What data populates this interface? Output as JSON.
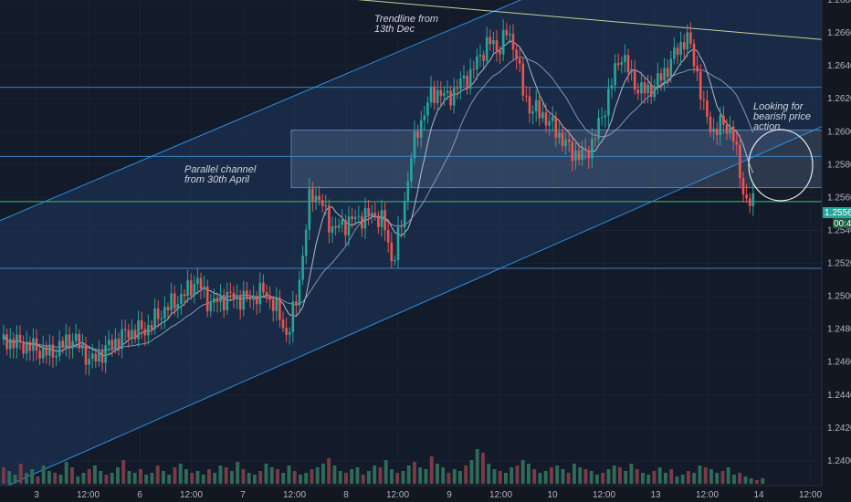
{
  "chart_data": {
    "type": "candlestick",
    "ylim": [
      1.2385,
      1.268
    ],
    "y_ticks": [
      "1.26600",
      "1.26400",
      "1.26200",
      "1.26000",
      "1.25800",
      "1.25600",
      "1.25400",
      "1.25200",
      "1.25000",
      "1.24800",
      "1.24600",
      "1.24400",
      "1.24200",
      "1.24000",
      "1.26800"
    ],
    "x_ticks": [
      "3",
      "12:00",
      "6",
      "12:00",
      "7",
      "12:00",
      "8",
      "12:00",
      "9",
      "12:00",
      "10",
      "12:00",
      "13",
      "12:00",
      "14",
      "12:00"
    ],
    "last_price": "1.25568",
    "countdown": "00:41",
    "annotations": {
      "trendline": [
        "Trendline from",
        "13th Dec"
      ],
      "channel": [
        "Parallel channel",
        "from 30th April"
      ],
      "looking": [
        "Looking for",
        "bearish price",
        "action"
      ]
    },
    "levels": [
      1.2627,
      1.2585,
      1.25575,
      1.2517
    ],
    "zone": [
      1.2566,
      1.2601
    ],
    "channel_upper": [
      [
        0,
        1.2546
      ],
      [
        570,
        1.268
      ]
    ],
    "channel_lower": [
      [
        0,
        1.2383
      ],
      [
        900,
        1.2603
      ]
    ],
    "trendline": [
      [
        355,
        1.2682
      ],
      [
        900,
        1.2656
      ]
    ],
    "price_path": [
      [
        0,
        1.2474
      ],
      [
        30,
        1.247
      ],
      [
        55,
        1.2465
      ],
      [
        80,
        1.2475
      ],
      [
        100,
        1.246
      ],
      [
        120,
        1.247
      ],
      [
        140,
        1.2478
      ],
      [
        160,
        1.248
      ],
      [
        180,
        1.2492
      ],
      [
        200,
        1.25
      ],
      [
        215,
        1.251
      ],
      [
        230,
        1.2495
      ],
      [
        250,
        1.25
      ],
      [
        270,
        1.2498
      ],
      [
        290,
        1.2503
      ],
      [
        305,
        1.249
      ],
      [
        315,
        1.2475
      ],
      [
        325,
        1.25
      ],
      [
        333,
        1.253
      ],
      [
        340,
        1.2565
      ],
      [
        348,
        1.256
      ],
      [
        357,
        1.255
      ],
      [
        365,
        1.254
      ],
      [
        380,
        1.2545
      ],
      [
        395,
        1.2548
      ],
      [
        410,
        1.255
      ],
      [
        420,
        1.2545
      ],
      [
        430,
        1.252
      ],
      [
        440,
        1.2545
      ],
      [
        450,
        1.2585
      ],
      [
        460,
        1.2605
      ],
      [
        470,
        1.262
      ],
      [
        480,
        1.2625
      ],
      [
        490,
        1.262
      ],
      [
        500,
        1.2627
      ],
      [
        515,
        1.2635
      ],
      [
        525,
        1.2645
      ],
      [
        535,
        1.2655
      ],
      [
        545,
        1.265
      ],
      [
        555,
        1.266
      ],
      [
        565,
        1.265
      ],
      [
        572,
        1.2625
      ],
      [
        580,
        1.2615
      ],
      [
        595,
        1.261
      ],
      [
        610,
        1.26
      ],
      [
        625,
        1.2588
      ],
      [
        640,
        1.2585
      ],
      [
        650,
        1.2595
      ],
      [
        660,
        1.261
      ],
      [
        670,
        1.263
      ],
      [
        680,
        1.2648
      ],
      [
        690,
        1.2635
      ],
      [
        700,
        1.2625
      ],
      [
        710,
        1.2625
      ],
      [
        720,
        1.263
      ],
      [
        730,
        1.2638
      ],
      [
        740,
        1.2648
      ],
      [
        752,
        1.2658
      ],
      [
        762,
        1.264
      ],
      [
        772,
        1.261
      ],
      [
        782,
        1.26
      ],
      [
        792,
        1.2605
      ],
      [
        802,
        1.26
      ],
      [
        812,
        1.257
      ],
      [
        818,
        1.2556
      ],
      [
        828,
        1.2557
      ]
    ],
    "volume_heights": [
      18,
      14,
      10,
      22,
      12,
      16,
      8,
      20,
      14,
      12,
      10,
      24,
      18,
      8,
      12,
      16,
      20,
      14,
      10,
      12,
      18,
      26,
      14,
      12,
      16,
      10,
      12,
      20,
      14,
      10,
      18,
      22,
      16,
      12,
      14,
      10,
      16,
      12,
      20,
      18,
      14,
      24,
      16,
      12,
      10,
      14,
      22,
      18,
      16,
      12,
      20,
      14,
      10,
      12,
      16,
      18,
      22,
      28,
      20,
      14,
      12,
      16,
      18,
      10,
      14,
      20,
      18,
      26,
      16,
      12,
      14,
      20,
      24,
      18,
      16,
      30,
      22,
      18,
      12,
      16,
      14,
      20,
      26,
      38,
      34,
      22,
      16,
      14,
      12,
      18,
      20,
      26,
      22,
      16,
      12,
      14,
      18,
      20,
      16,
      12,
      22,
      18,
      16,
      14,
      10,
      12,
      16,
      20,
      18,
      14,
      22,
      16,
      12,
      10,
      14,
      18,
      12,
      16,
      8,
      10,
      14,
      12,
      20,
      18,
      16,
      12,
      14,
      18,
      10,
      12,
      8,
      6,
      4,
      6
    ]
  }
}
